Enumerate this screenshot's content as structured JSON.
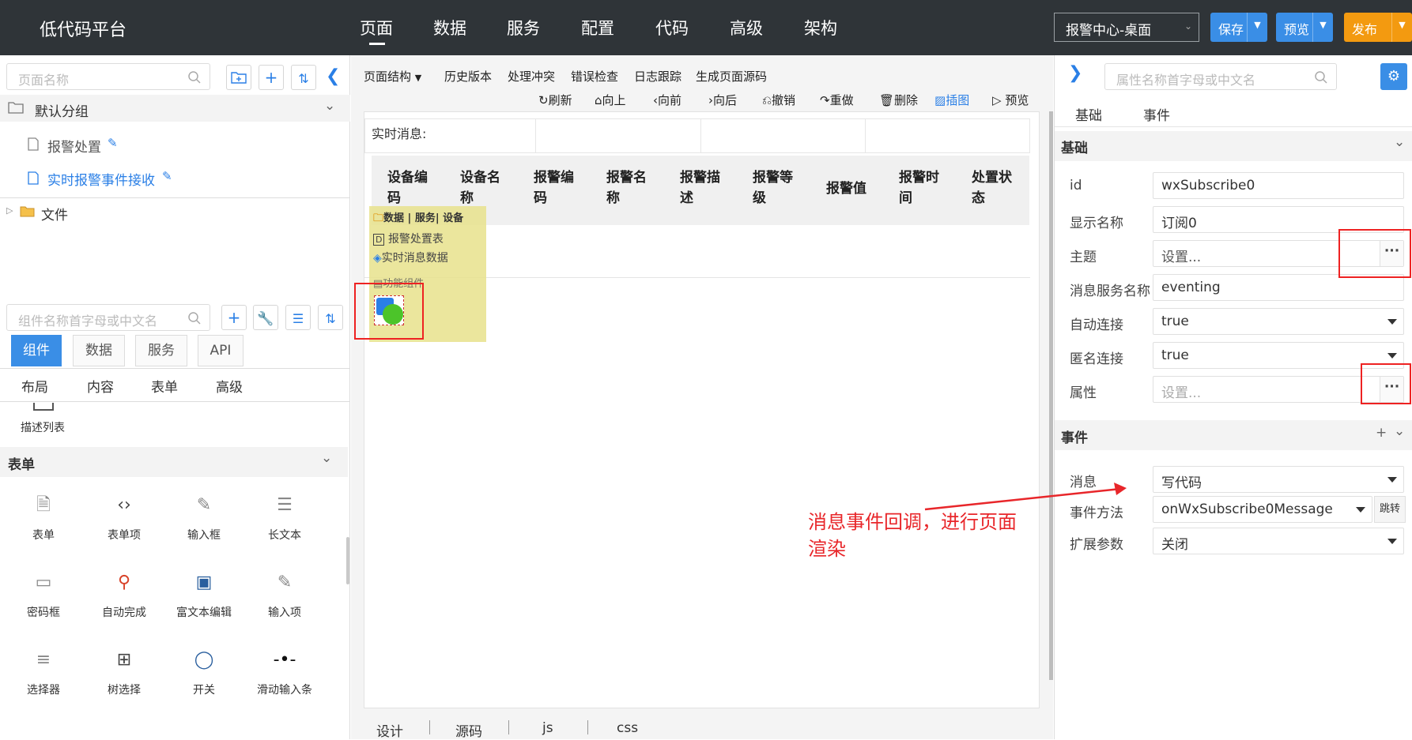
{
  "app": {
    "title": "低代码平台"
  },
  "nav": [
    "页面",
    "数据",
    "服务",
    "配置",
    "代码",
    "高级",
    "架构"
  ],
  "header": {
    "page_select": "报警中心-桌面",
    "save": "保存",
    "preview": "预览",
    "publish": "发布"
  },
  "left": {
    "page_search_placeholder": "页面名称",
    "group_label": "默认分组",
    "pages": [
      "报警处置",
      "实时报警事件接收"
    ],
    "file_node": "文件",
    "comp_search_placeholder": "组件名称首字母或中文名",
    "tabs": [
      "组件",
      "数据",
      "服务",
      "API"
    ],
    "subtabs": [
      "布局",
      "内容",
      "表单",
      "高级"
    ],
    "prev_item": "描述列表",
    "section": "表单",
    "components": [
      "表单",
      "表单项",
      "输入框",
      "长文本",
      "密码框",
      "自动完成",
      "富文本编辑",
      "输入项",
      "选择器",
      "树选择",
      "开关",
      "滑动输入条"
    ]
  },
  "center": {
    "toolbar": [
      "页面结构",
      "历史版本",
      "处理冲突",
      "错误检查",
      "日志跟踪",
      "生成页面源码"
    ],
    "actions": [
      "刷新",
      "向上",
      "向前",
      "向后",
      "撤销",
      "重做",
      "删除",
      "插图",
      "预览"
    ],
    "realtime_label": "实时消息:",
    "columns": [
      [
        "设备编",
        "码"
      ],
      [
        "设备名",
        "称"
      ],
      [
        "报警编",
        "码"
      ],
      [
        "报警名",
        "称"
      ],
      [
        "报警描",
        "述"
      ],
      [
        "报警等",
        "级"
      ],
      [
        "报警值",
        ""
      ],
      [
        "报警时",
        "间"
      ],
      [
        "处置状",
        "态"
      ]
    ],
    "popup": {
      "header": "数据 | 服务| 设备",
      "items": [
        "报警处置表",
        "实时消息数据"
      ],
      "section": "功能组件"
    },
    "bottom_tabs": [
      "设计",
      "源码",
      "js",
      "css"
    ]
  },
  "right": {
    "search_placeholder": "属性名称首字母或中文名",
    "tabs": [
      "基础",
      "事件"
    ],
    "section_basic": "基础",
    "props": [
      {
        "label": "id",
        "value": "wxSubscribe0",
        "kind": "text"
      },
      {
        "label": "显示名称",
        "value": "订阅0",
        "kind": "text"
      },
      {
        "label": "主题",
        "value": "设置...",
        "kind": "dots"
      },
      {
        "label": "消息服务名称",
        "value": "eventing",
        "kind": "text"
      },
      {
        "label": "自动连接",
        "value": "true",
        "kind": "select"
      },
      {
        "label": "匿名连接",
        "value": "true",
        "kind": "select"
      },
      {
        "label": "属性",
        "value": "设置...",
        "kind": "dots"
      }
    ],
    "section_event": "事件",
    "events": [
      {
        "label": "消息",
        "value": "写代码"
      },
      {
        "label": "事件方法",
        "value": "onWxSubscribe0Message",
        "btn": "跳转"
      },
      {
        "label": "扩展参数",
        "value": "关闭"
      }
    ]
  },
  "annotation": {
    "line1": "消息事件回调，进行页面",
    "line2": "渲染",
    "color": "#e8262a"
  },
  "colors": {
    "topbar": "#2f3438",
    "accent": "#2a7fe6",
    "publish": "#f39a10",
    "save": "#3a8ee6"
  }
}
